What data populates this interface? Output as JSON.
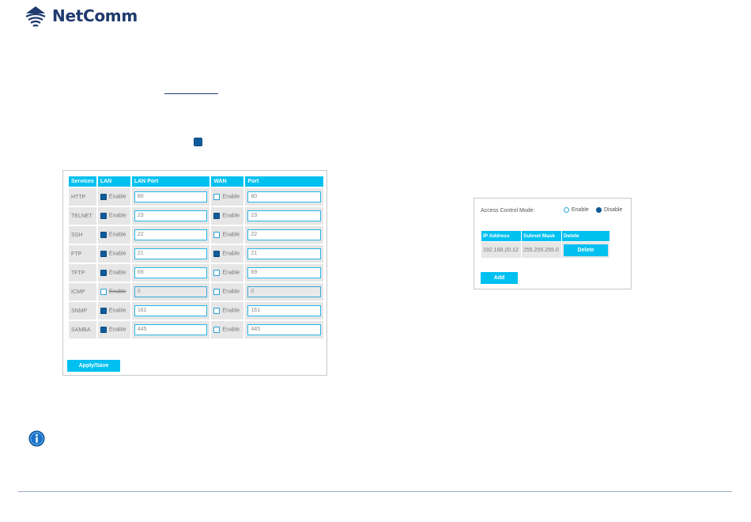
{
  "logo": {
    "text": "NetComm",
    "color": "#1f3a6e"
  },
  "accent_color": "#00c0f0",
  "checkbox_checked_color": "#0f5c9c",
  "services": {
    "headers": [
      "Services",
      "LAN",
      "LAN Port",
      "WAN",
      "Port"
    ],
    "rows": [
      {
        "name": "HTTP",
        "lan_enabled": true,
        "lan_label": "Enable",
        "lan_port": "80",
        "lan_port_disabled": false,
        "wan_enabled": false,
        "wan_label": "Enable",
        "wan_port": "80",
        "wan_port_disabled": false
      },
      {
        "name": "TELNET",
        "lan_enabled": true,
        "lan_label": "Enable",
        "lan_port": "23",
        "lan_port_disabled": false,
        "wan_enabled": true,
        "wan_label": "Enable",
        "wan_port": "23",
        "wan_port_disabled": false
      },
      {
        "name": "SSH",
        "lan_enabled": true,
        "lan_label": "Enable",
        "lan_port": "22",
        "lan_port_disabled": false,
        "wan_enabled": false,
        "wan_label": "Enable",
        "wan_port": "22",
        "wan_port_disabled": false
      },
      {
        "name": "FTP",
        "lan_enabled": true,
        "lan_label": "Enable",
        "lan_port": "21",
        "lan_port_disabled": false,
        "wan_enabled": true,
        "wan_label": "Enable",
        "wan_port": "21",
        "wan_port_disabled": false
      },
      {
        "name": "TFTP",
        "lan_enabled": true,
        "lan_label": "Enable",
        "lan_port": "69",
        "lan_port_disabled": false,
        "wan_enabled": false,
        "wan_label": "Enable",
        "wan_port": "69",
        "wan_port_disabled": false
      },
      {
        "name": "ICMP",
        "lan_enabled": false,
        "lan_label": "Enable",
        "lan_label_struck": true,
        "lan_port": "0",
        "lan_port_disabled": true,
        "wan_enabled": false,
        "wan_label": "Enable",
        "wan_port": "0",
        "wan_port_disabled": true
      },
      {
        "name": "SNMP",
        "lan_enabled": true,
        "lan_label": "Enable",
        "lan_port": "161",
        "lan_port_disabled": false,
        "wan_enabled": false,
        "wan_label": "Enable",
        "wan_port": "161",
        "wan_port_disabled": false
      },
      {
        "name": "SAMBA",
        "lan_enabled": true,
        "lan_label": "Enable",
        "lan_port": "445",
        "lan_port_disabled": false,
        "wan_enabled": false,
        "wan_label": "Enable",
        "wan_port": "445",
        "wan_port_disabled": false
      }
    ],
    "apply_label": "Apply/Save"
  },
  "access_control": {
    "mode_label": "Access Control Mode:",
    "enable_label": "Enable",
    "disable_label": "Disable",
    "selected": "Disable",
    "headers": [
      "IP Address",
      "Subnet Mask",
      "Delete"
    ],
    "rows": [
      {
        "ip": "192.168.20.12",
        "mask": "255.255.255.0",
        "delete_label": "Delete"
      }
    ],
    "add_label": "Add"
  }
}
